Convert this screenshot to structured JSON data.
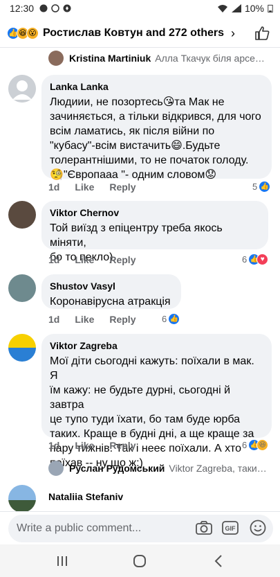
{
  "status_bar": {
    "time": "12:30",
    "battery": "10%"
  },
  "header": {
    "reactors": "Ростислав Ковтун and 272 others",
    "chevron": "›"
  },
  "reply_preview_top": {
    "author": "Kristina Martiniuk",
    "snippet": "Алла Ткачук біля арсену б..."
  },
  "comments": [
    {
      "author": "Lanka Lanka",
      "lines": [
        "Людиии, не позортесь😘та Мак не",
        "зачиняється, а тільки відкрився, для чого",
        "всім ламатись, як після війни по",
        "\"кубасу\"-всім вистачить😄.Будьте",
        "толерантнішими, то не початок голоду.",
        "🧐\"Європааа \"- одним словом😟"
      ],
      "age": "1d",
      "like": "Like",
      "reply": "Reply",
      "reactions": "5"
    },
    {
      "author": "Viktor Chernov",
      "lines": [
        "Той виїзд з епіцентру треба якось міняти,",
        "бо то пекло)"
      ],
      "age": "1d",
      "like": "Like",
      "reply": "Reply",
      "reactions": "6"
    },
    {
      "author": "Shustov Vasyl",
      "lines": [
        "Коронавірусна атракція"
      ],
      "age": "1d",
      "like": "Like",
      "reply": "Reply",
      "reactions": "6"
    },
    {
      "author": "Viktor Zagreba",
      "lines": [
        "Мої діти сьогодні кажуть: поїхали в мак. Я",
        "їм кажу: не будьте дурні, сьогодні й завтра",
        "це тупо туди їхати, бо там буде юрба",
        "таких. Краще в будні дні, а ще краще за",
        "пару тижнів. Так і нееє поїхали. А хто",
        "поїхав -- ну що ж:)"
      ],
      "age": "1d",
      "like": "Like",
      "reply": "Reply",
      "reactions": "6"
    }
  ],
  "reply_preview_bottom": {
    "author": "Руслан Рудомський",
    "snippet": "Viktor Zagreba, таким те..."
  },
  "next_comment": {
    "author": "Nataliia Stefaniv"
  },
  "composer": {
    "placeholder": "Write a public comment..."
  },
  "colors": {
    "accent": "#1877f2",
    "bubble": "#f0f2f5",
    "muted": "#65676b"
  }
}
